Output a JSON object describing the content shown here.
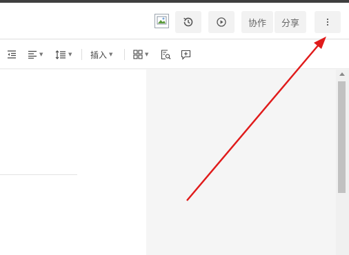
{
  "header": {
    "collaborate_label": "协作",
    "share_label": "分享",
    "avatar_icon": "broken-image-icon",
    "history_icon": "history-icon",
    "play_icon": "play-icon",
    "more_icon": "more-vertical-icon"
  },
  "toolbar": {
    "outdent_icon": "outdent-icon",
    "align_icon": "align-left-icon",
    "line_spacing_icon": "line-spacing-icon",
    "insert_label": "插入",
    "grid_icon": "grid-icon",
    "find_icon": "find-in-page-icon",
    "comment_icon": "add-comment-icon"
  },
  "annotation": {
    "color": "#e01b1b"
  },
  "colors": {
    "accent": "#e01b1b",
    "toolbar_text": "#444444",
    "button_bg": "#f2f2f2"
  }
}
